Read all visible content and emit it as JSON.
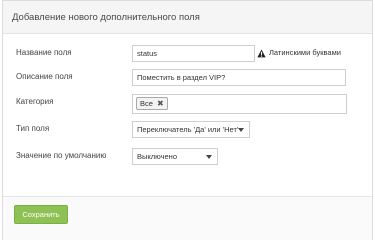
{
  "panel": {
    "title": "Добавление нового дополнительного поля"
  },
  "form": {
    "name": {
      "label": "Название поля",
      "value": "status",
      "hint": "Латинскими буквами",
      "hint_icon": "warning-icon"
    },
    "description": {
      "label": "Описание поля",
      "value": "Поместить в раздел VIP?"
    },
    "category": {
      "label": "Категория",
      "chips": [
        "Все"
      ],
      "chip_remove_glyph": "✖"
    },
    "type": {
      "label": "Тип поля",
      "selected": "Переключатель 'Да' или 'Нет'"
    },
    "default": {
      "label": "Значение по умолчанию",
      "selected": "Выключено"
    }
  },
  "footer": {
    "save_label": "Сохранить"
  },
  "colors": {
    "save_button": "#8dc153",
    "border": "#cfcfcf",
    "header_bg": "#f5f5f5"
  }
}
